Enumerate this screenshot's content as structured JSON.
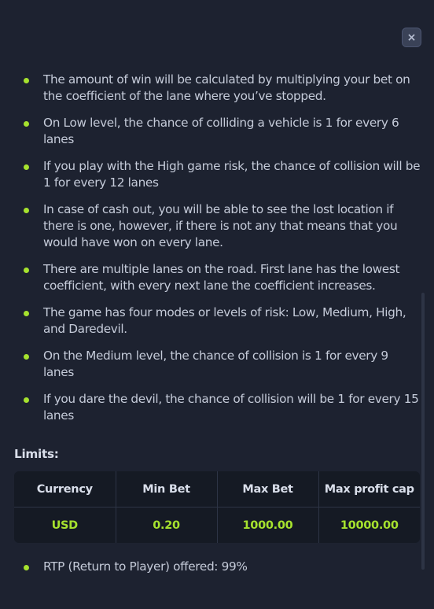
{
  "close_label": "×",
  "rules": [
    "The amount of win will be calculated by multiplying your bet on the coefficient of the lane where you’ve stopped.",
    "On Low level, the chance of colliding a vehicle is 1 for every 6 lanes",
    "If you play with the High game risk, the chance of collision will be 1 for every 12 lanes",
    "In case of cash out, you will be able to see the lost location if there is one, however, if there is not any that means that you would have won on every lane.",
    "There are multiple lanes on the road. First lane has the lowest coefficient, with every next lane the coefficient increases.",
    "The game has four modes or levels of risk: Low, Medium, High, and Daredevil.",
    "On the Medium level, the chance of collision is 1 for every 9 lanes",
    "If you dare the devil, the chance of collision will be 1 for every 15 lanes"
  ],
  "limits": {
    "title": "Limits:",
    "headers": [
      "Currency",
      "Min Bet",
      "Max Bet",
      "Max profit cap"
    ],
    "rows": [
      [
        "USD",
        "0.20",
        "1000.00",
        "10000.00"
      ]
    ]
  },
  "rtp": "RTP (Return to Player) offered: 99%",
  "colors": {
    "background": "#1d2230",
    "accent": "#a6e22e",
    "text": "#c5cbd9",
    "table_bg": "#151a24"
  }
}
